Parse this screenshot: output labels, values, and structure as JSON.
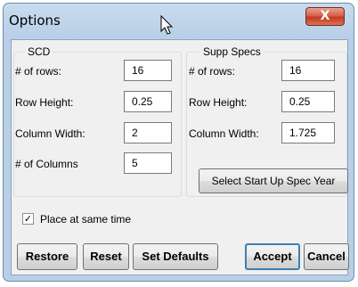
{
  "window": {
    "title": "Options",
    "close_symbol": "X"
  },
  "scd": {
    "legend": "SCD",
    "rows_label": "# of rows:",
    "rows_value": "16",
    "height_label": "Row Height:",
    "height_value": "0.25",
    "width_label": "Column Width:",
    "width_value": "2",
    "cols_label": "# of Columns",
    "cols_value": "5"
  },
  "supp": {
    "legend": "Supp Specs",
    "rows_label": "# of rows:",
    "rows_value": "16",
    "height_label": "Row Height:",
    "height_value": "0.25",
    "width_label": "Column Width:",
    "width_value": "1.725",
    "year_button": "Select Start Up Spec Year"
  },
  "place": {
    "label": "Place at same time",
    "checked": true,
    "mark": "✓"
  },
  "buttons": {
    "restore": "Restore",
    "reset": "Reset",
    "defaults": "Set Defaults",
    "accept": "Accept",
    "cancel": "Cancel"
  }
}
